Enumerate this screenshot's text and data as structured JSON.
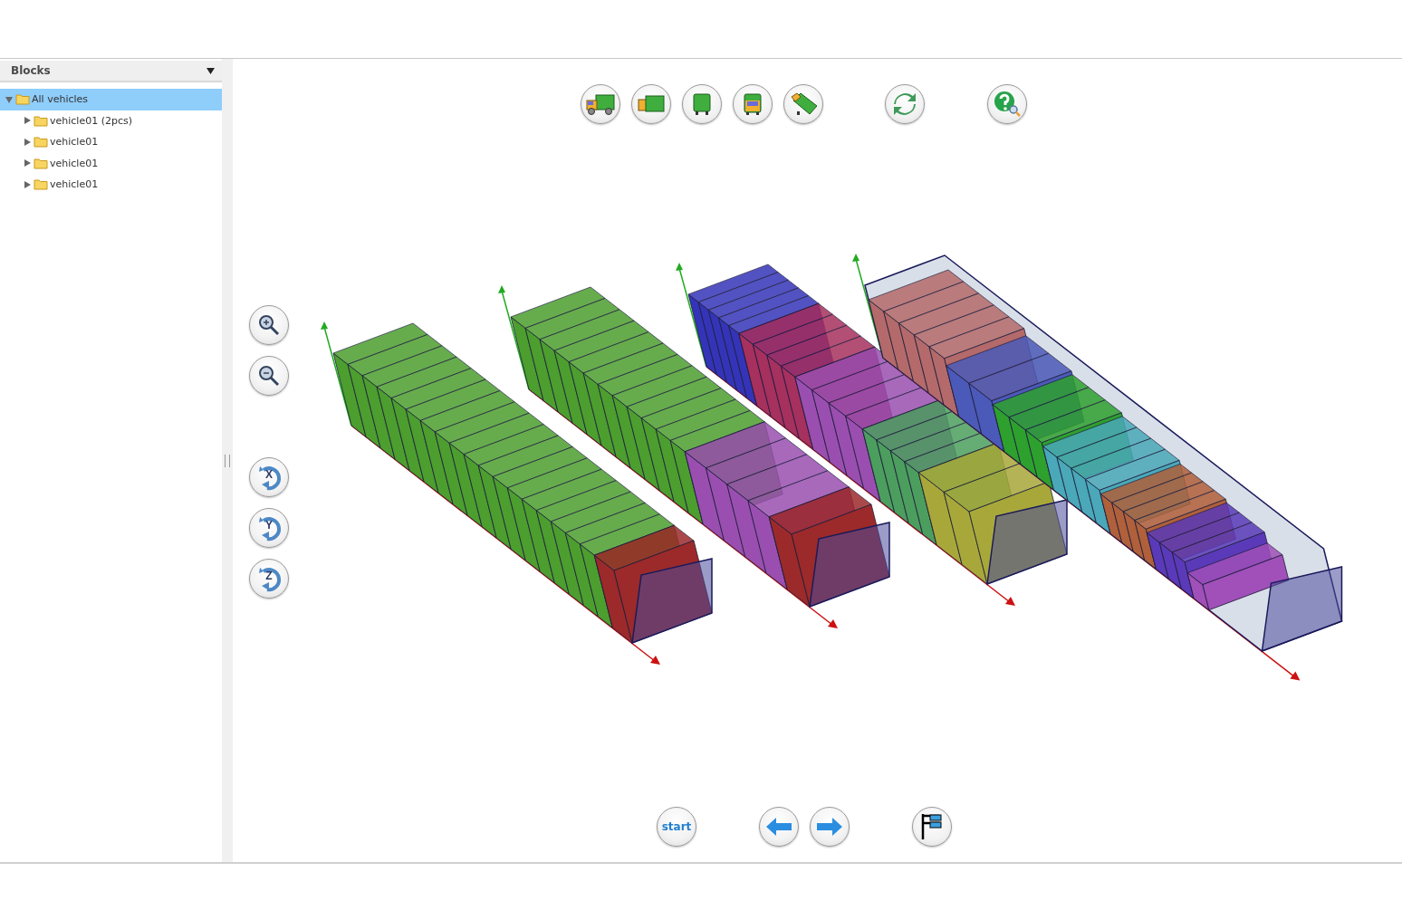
{
  "sidebar": {
    "title": "Blocks",
    "tree": [
      {
        "label": "All vehicles",
        "selected": true,
        "expanded": true,
        "children": [
          {
            "label": "vehicle01 (2pcs)",
            "selected": false,
            "expanded": false
          },
          {
            "label": "vehicle01",
            "selected": false,
            "expanded": false
          },
          {
            "label": "vehicle01",
            "selected": false,
            "expanded": false
          },
          {
            "label": "vehicle01",
            "selected": false,
            "expanded": false
          }
        ]
      }
    ]
  },
  "rotate_buttons": [
    {
      "label": "X"
    },
    {
      "label": "Y"
    },
    {
      "label": "Z"
    }
  ],
  "start_button": {
    "label": "start"
  }
}
